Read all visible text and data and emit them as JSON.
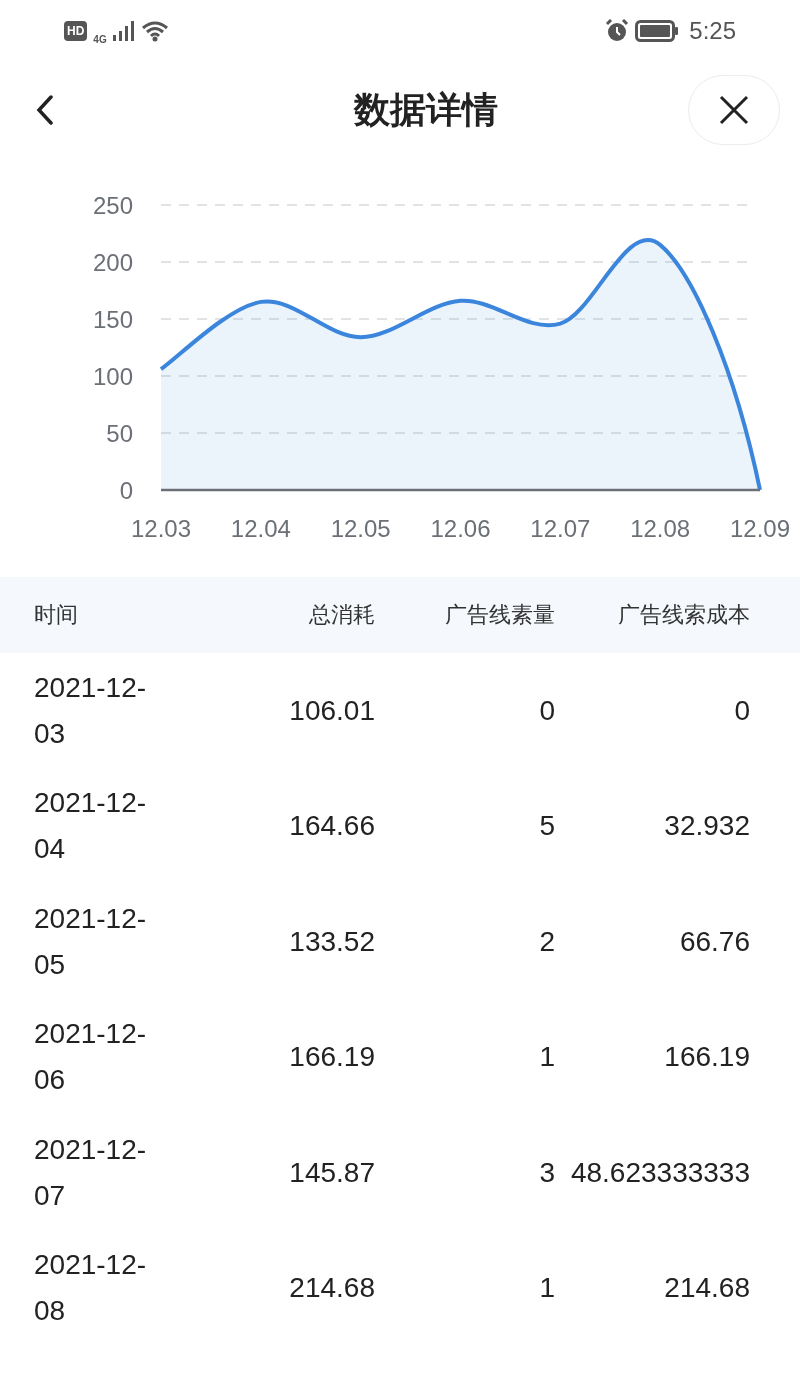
{
  "status_bar": {
    "hd_badge": "HD",
    "network": "4G",
    "time": "5:25"
  },
  "header": {
    "title": "数据详情"
  },
  "chart": {
    "chart_data": {
      "type": "area",
      "categories": [
        "12.03",
        "12.04",
        "12.05",
        "12.06",
        "12.07",
        "12.08",
        "12.09"
      ],
      "ylim": [
        0,
        250
      ],
      "grid": true,
      "yticks": [
        0,
        50,
        100,
        150,
        200,
        250
      ],
      "series": [
        {
          "color": "#3b86dc",
          "values": [
            106,
            165,
            134,
            166,
            146,
            215,
            0
          ]
        }
      ]
    }
  },
  "table": {
    "columns": [
      "时间",
      "总消耗",
      "广告线素量",
      "广告线索成本"
    ],
    "rows": [
      {
        "cells": [
          "2021-12-03",
          "106.01",
          "0",
          "0"
        ]
      },
      {
        "cells": [
          "2021-12-04",
          "164.66",
          "5",
          "32.932"
        ]
      },
      {
        "cells": [
          "2021-12-05",
          "133.52",
          "2",
          "66.76"
        ]
      },
      {
        "cells": [
          "2021-12-06",
          "166.19",
          "1",
          "166.19"
        ]
      },
      {
        "cells": [
          "2021-12-07",
          "145.87",
          "3",
          "48.623333333"
        ]
      },
      {
        "cells": [
          "2021-12-08",
          "214.68",
          "1",
          "214.68"
        ]
      }
    ]
  }
}
